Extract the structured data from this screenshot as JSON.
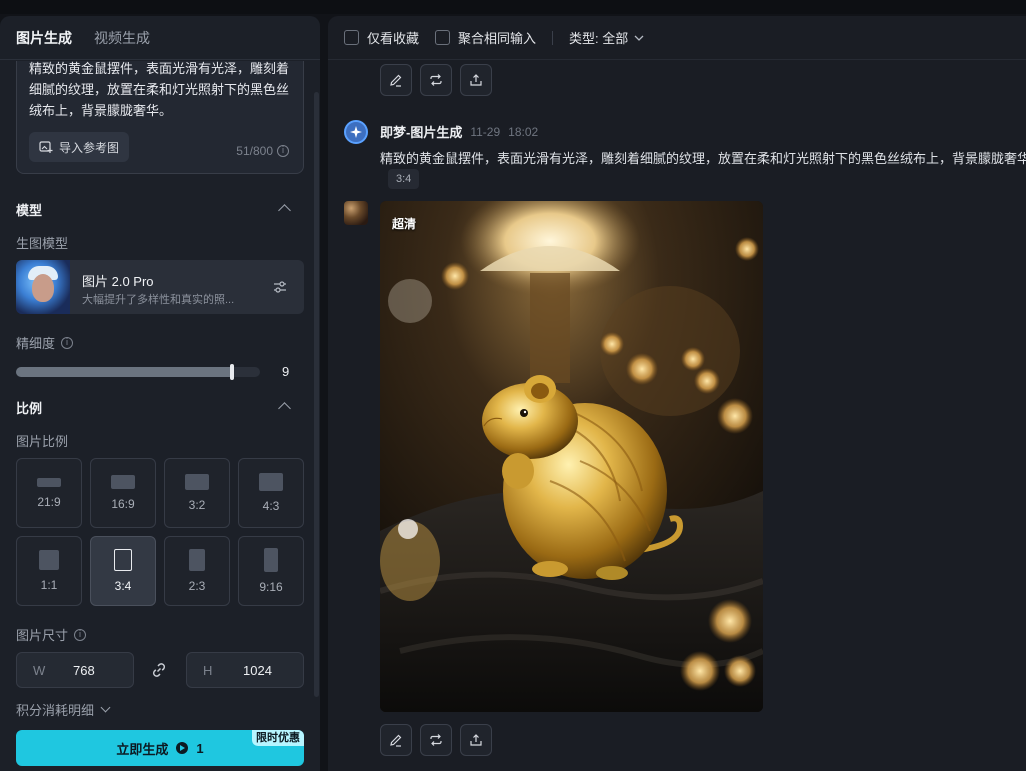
{
  "left_panel": {
    "tabs": [
      {
        "label": "图片生成",
        "active": true
      },
      {
        "label": "视频生成",
        "active": false
      }
    ],
    "prompt": {
      "text": "精致的黄金鼠摆件，表面光滑有光泽，雕刻着细腻的纹理，放置在柔和灯光照射下的黑色丝绒布上，背景朦胧奢华。",
      "import_label": "导入参考图",
      "counter": "51/800"
    },
    "model_section": {
      "title": "模型",
      "sub_title": "生图模型",
      "model_name": "图片 2.0 Pro",
      "model_desc": "大幅提升了多样性和真实的照..."
    },
    "detail": {
      "label": "精细度",
      "value": "9",
      "fraction": 0.9
    },
    "ratio_section": {
      "title": "比例",
      "sub_title": "图片比例",
      "options": [
        "21:9",
        "16:9",
        "3:2",
        "4:3",
        "1:1",
        "3:4",
        "2:3",
        "9:16"
      ],
      "selected": "3:4"
    },
    "size": {
      "label": "图片尺寸",
      "w_label": "W",
      "w_value": "768",
      "h_label": "H",
      "h_value": "1024"
    },
    "credits_label": "积分消耗明细",
    "generate": {
      "label": "立即生成",
      "cost": "1",
      "promo": "限时优惠"
    }
  },
  "filter_bar": {
    "favorites_label": "仅看收藏",
    "merge_label": "聚合相同输入",
    "type_label": "类型: 全部"
  },
  "message": {
    "name": "即梦-图片生成",
    "date": "11-29",
    "time": "18:02",
    "prompt": "精致的黄金鼠摆件，表面光滑有光泽，雕刻着细腻的纹理，放置在柔和灯光照射下的黑色丝绒布上，背景朦胧奢华",
    "ratio_chip": "3:4",
    "image_badge": "超清"
  },
  "colors": {
    "accent": "#1fc7e0",
    "panel": "#1c2028",
    "background": "#1a1d24"
  }
}
